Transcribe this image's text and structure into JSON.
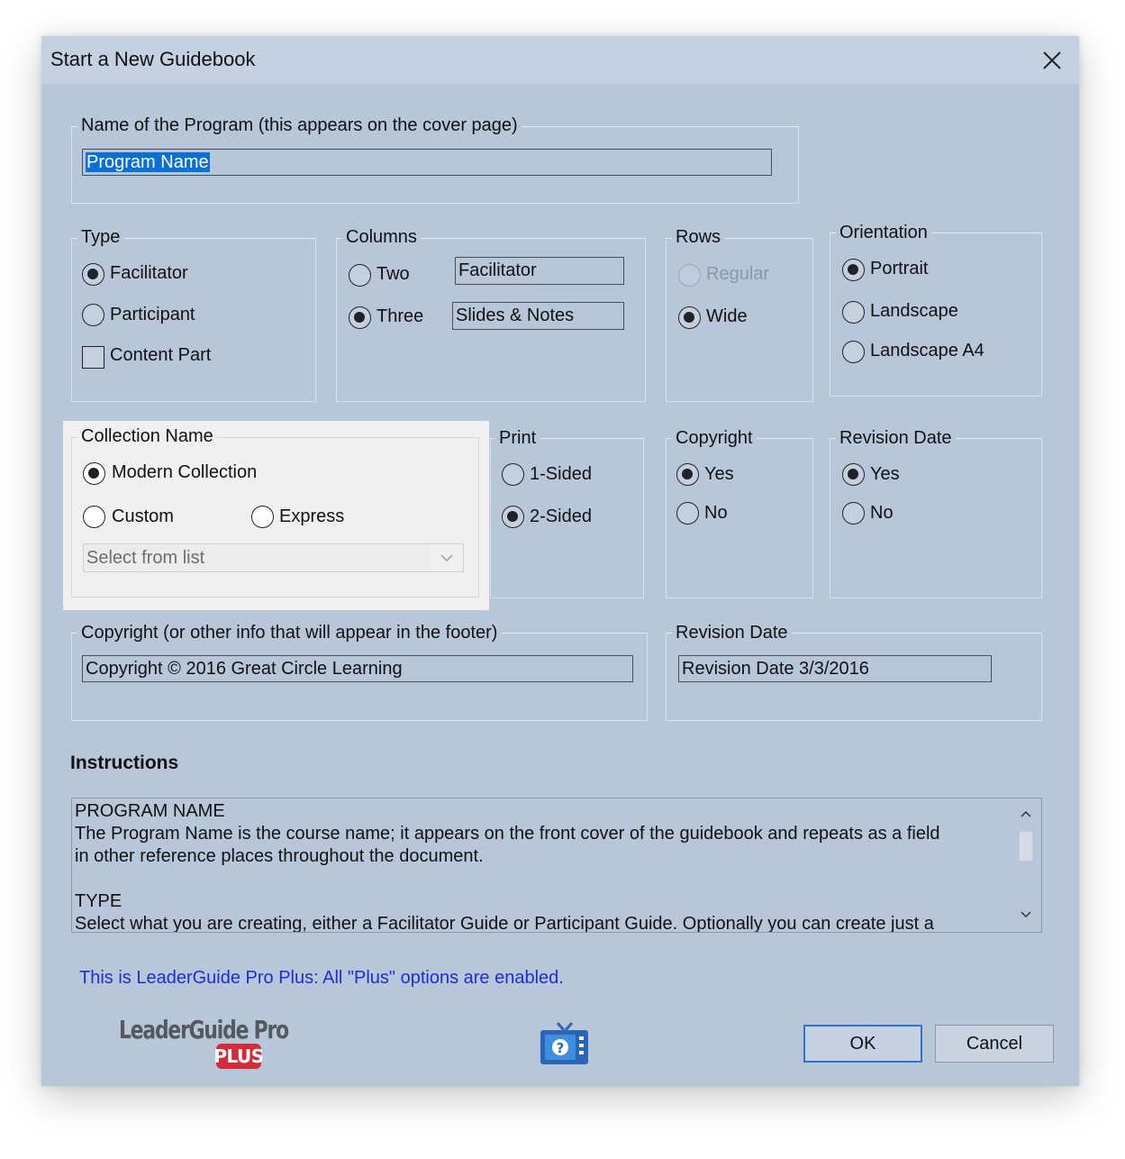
{
  "window": {
    "title": "Start a New Guidebook"
  },
  "program": {
    "legend": "Name of the Program (this appears on the cover page)",
    "value": "Program Name"
  },
  "type": {
    "legend": "Type",
    "options": [
      {
        "label": "Facilitator",
        "checked": true
      },
      {
        "label": "Participant",
        "checked": false
      }
    ],
    "content_part": {
      "label": "Content Part",
      "checked": false
    }
  },
  "columns": {
    "legend": "Columns",
    "options": [
      {
        "label": "Two",
        "checked": false,
        "field": "Facilitator"
      },
      {
        "label": "Three",
        "checked": true,
        "field": "Slides & Notes"
      }
    ]
  },
  "rows": {
    "legend": "Rows",
    "options": [
      {
        "label": "Regular",
        "checked": false,
        "disabled": true
      },
      {
        "label": "Wide",
        "checked": true
      }
    ]
  },
  "orientation": {
    "legend": "Orientation",
    "options": [
      {
        "label": "Portrait",
        "checked": true
      },
      {
        "label": "Landscape",
        "checked": false
      },
      {
        "label": "Landscape A4",
        "checked": false
      }
    ]
  },
  "collection": {
    "legend": "Collection Name",
    "options": [
      {
        "label": "Modern Collection",
        "checked": true
      },
      {
        "label": "Custom",
        "checked": false
      },
      {
        "label": "Express",
        "checked": false
      }
    ],
    "select_placeholder": "Select from list"
  },
  "print": {
    "legend": "Print",
    "options": [
      {
        "label": "1-Sided",
        "checked": false
      },
      {
        "label": "2-Sided",
        "checked": true
      }
    ]
  },
  "copyright_toggle": {
    "legend": "Copyright",
    "options": [
      {
        "label": "Yes",
        "checked": true
      },
      {
        "label": "No",
        "checked": false
      }
    ]
  },
  "revision_toggle": {
    "legend": "Revision Date",
    "options": [
      {
        "label": "Yes",
        "checked": true
      },
      {
        "label": "No",
        "checked": false
      }
    ]
  },
  "footer_copyright": {
    "legend": "Copyright (or other info that will appear in the footer)",
    "value": "Copyright © 2016 Great Circle Learning"
  },
  "footer_revision": {
    "legend": "Revision Date",
    "value": "Revision Date 3/3/2016"
  },
  "instructions": {
    "title": "Instructions",
    "lines": [
      "PROGRAM NAME",
      "The Program Name is the course name; it appears on the front cover of the guidebook and repeats as a field",
      "in other reference places throughout the document.",
      "",
      "TYPE",
      "Select what you are creating, either a Facilitator Guide or Participant Guide. Optionally you can create just a"
    ]
  },
  "plus_note": "This is LeaderGuide Pro Plus: All \"Plus\" options are enabled.",
  "logo": {
    "main": "LeaderGuide Pro",
    "badge": "PLUS"
  },
  "buttons": {
    "ok": "OK",
    "cancel": "Cancel"
  },
  "icons": {
    "close": "close-icon",
    "help_video": "tv-help-icon",
    "dropdown": "chevron-down-icon",
    "scroll_up": "chevron-up-icon",
    "scroll_down": "chevron-down-icon"
  },
  "colors": {
    "dialog_bg": "#b8c6d9",
    "titlebar_bg": "#c4d1e2",
    "selection": "#0a6fd6",
    "plus_note": "#1a2fd8",
    "logo_badge": "#d42a3b",
    "ok_border": "#2f74c7"
  }
}
